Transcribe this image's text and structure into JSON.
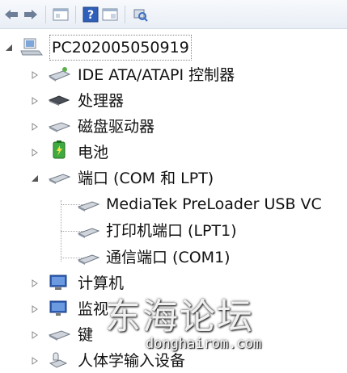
{
  "toolbar": {
    "buttons": [
      {
        "icon": "back-arrow-icon"
      },
      {
        "icon": "forward-arrow-icon"
      },
      {
        "icon": "properties-icon"
      },
      {
        "icon": "help-icon"
      },
      {
        "icon": "console-tree-icon"
      },
      {
        "icon": "scan-hardware-icon"
      }
    ]
  },
  "tree": {
    "root": {
      "label": "PC202005050919",
      "icon": "computer-icon",
      "expanded": true
    },
    "items": [
      {
        "label": "IDE ATA/ATAPI 控制器",
        "icon": "ide-controller-icon",
        "expanded": false
      },
      {
        "label": "处理器",
        "icon": "processor-icon",
        "expanded": false
      },
      {
        "label": "磁盘驱动器",
        "icon": "disk-drive-icon",
        "expanded": false
      },
      {
        "label": "电池",
        "icon": "battery-icon",
        "expanded": false
      },
      {
        "label": "端口 (COM 和 LPT)",
        "icon": "port-icon",
        "expanded": true,
        "children": [
          {
            "label": "MediaTek PreLoader USB VC",
            "icon": "port-icon"
          },
          {
            "label": "打印机端口 (LPT1)",
            "icon": "port-icon"
          },
          {
            "label": "通信端口 (COM1)",
            "icon": "port-icon"
          }
        ]
      },
      {
        "label": "计算机",
        "icon": "monitor-computer-icon",
        "expanded": false
      },
      {
        "label": "监视",
        "icon": "monitor-icon",
        "expanded": false
      },
      {
        "label": "键",
        "icon": "keyboard-icon",
        "expanded": false
      },
      {
        "label": "人体学输入设备",
        "icon": "hid-icon",
        "expanded": false
      }
    ]
  },
  "watermark": {
    "cn": "东海论坛",
    "en": "donghairom.com"
  }
}
